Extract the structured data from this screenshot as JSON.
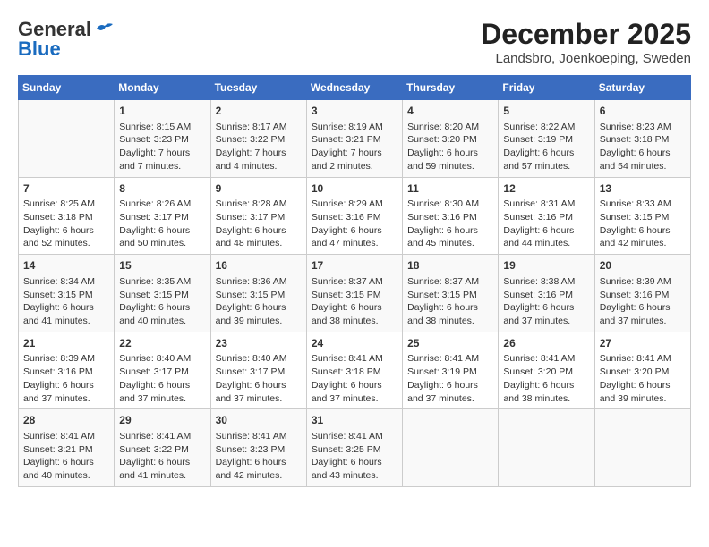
{
  "header": {
    "logo_general": "General",
    "logo_blue": "Blue",
    "title": "December 2025",
    "subtitle": "Landsbro, Joenkoeping, Sweden"
  },
  "days_of_week": [
    "Sunday",
    "Monday",
    "Tuesday",
    "Wednesday",
    "Thursday",
    "Friday",
    "Saturday"
  ],
  "weeks": [
    [
      {
        "day": "",
        "info": ""
      },
      {
        "day": "1",
        "info": "Sunrise: 8:15 AM\nSunset: 3:23 PM\nDaylight: 7 hours\nand 7 minutes."
      },
      {
        "day": "2",
        "info": "Sunrise: 8:17 AM\nSunset: 3:22 PM\nDaylight: 7 hours\nand 4 minutes."
      },
      {
        "day": "3",
        "info": "Sunrise: 8:19 AM\nSunset: 3:21 PM\nDaylight: 7 hours\nand 2 minutes."
      },
      {
        "day": "4",
        "info": "Sunrise: 8:20 AM\nSunset: 3:20 PM\nDaylight: 6 hours\nand 59 minutes."
      },
      {
        "day": "5",
        "info": "Sunrise: 8:22 AM\nSunset: 3:19 PM\nDaylight: 6 hours\nand 57 minutes."
      },
      {
        "day": "6",
        "info": "Sunrise: 8:23 AM\nSunset: 3:18 PM\nDaylight: 6 hours\nand 54 minutes."
      }
    ],
    [
      {
        "day": "7",
        "info": "Sunrise: 8:25 AM\nSunset: 3:18 PM\nDaylight: 6 hours\nand 52 minutes."
      },
      {
        "day": "8",
        "info": "Sunrise: 8:26 AM\nSunset: 3:17 PM\nDaylight: 6 hours\nand 50 minutes."
      },
      {
        "day": "9",
        "info": "Sunrise: 8:28 AM\nSunset: 3:17 PM\nDaylight: 6 hours\nand 48 minutes."
      },
      {
        "day": "10",
        "info": "Sunrise: 8:29 AM\nSunset: 3:16 PM\nDaylight: 6 hours\nand 47 minutes."
      },
      {
        "day": "11",
        "info": "Sunrise: 8:30 AM\nSunset: 3:16 PM\nDaylight: 6 hours\nand 45 minutes."
      },
      {
        "day": "12",
        "info": "Sunrise: 8:31 AM\nSunset: 3:16 PM\nDaylight: 6 hours\nand 44 minutes."
      },
      {
        "day": "13",
        "info": "Sunrise: 8:33 AM\nSunset: 3:15 PM\nDaylight: 6 hours\nand 42 minutes."
      }
    ],
    [
      {
        "day": "14",
        "info": "Sunrise: 8:34 AM\nSunset: 3:15 PM\nDaylight: 6 hours\nand 41 minutes."
      },
      {
        "day": "15",
        "info": "Sunrise: 8:35 AM\nSunset: 3:15 PM\nDaylight: 6 hours\nand 40 minutes."
      },
      {
        "day": "16",
        "info": "Sunrise: 8:36 AM\nSunset: 3:15 PM\nDaylight: 6 hours\nand 39 minutes."
      },
      {
        "day": "17",
        "info": "Sunrise: 8:37 AM\nSunset: 3:15 PM\nDaylight: 6 hours\nand 38 minutes."
      },
      {
        "day": "18",
        "info": "Sunrise: 8:37 AM\nSunset: 3:15 PM\nDaylight: 6 hours\nand 38 minutes."
      },
      {
        "day": "19",
        "info": "Sunrise: 8:38 AM\nSunset: 3:16 PM\nDaylight: 6 hours\nand 37 minutes."
      },
      {
        "day": "20",
        "info": "Sunrise: 8:39 AM\nSunset: 3:16 PM\nDaylight: 6 hours\nand 37 minutes."
      }
    ],
    [
      {
        "day": "21",
        "info": "Sunrise: 8:39 AM\nSunset: 3:16 PM\nDaylight: 6 hours\nand 37 minutes."
      },
      {
        "day": "22",
        "info": "Sunrise: 8:40 AM\nSunset: 3:17 PM\nDaylight: 6 hours\nand 37 minutes."
      },
      {
        "day": "23",
        "info": "Sunrise: 8:40 AM\nSunset: 3:17 PM\nDaylight: 6 hours\nand 37 minutes."
      },
      {
        "day": "24",
        "info": "Sunrise: 8:41 AM\nSunset: 3:18 PM\nDaylight: 6 hours\nand 37 minutes."
      },
      {
        "day": "25",
        "info": "Sunrise: 8:41 AM\nSunset: 3:19 PM\nDaylight: 6 hours\nand 37 minutes."
      },
      {
        "day": "26",
        "info": "Sunrise: 8:41 AM\nSunset: 3:20 PM\nDaylight: 6 hours\nand 38 minutes."
      },
      {
        "day": "27",
        "info": "Sunrise: 8:41 AM\nSunset: 3:20 PM\nDaylight: 6 hours\nand 39 minutes."
      }
    ],
    [
      {
        "day": "28",
        "info": "Sunrise: 8:41 AM\nSunset: 3:21 PM\nDaylight: 6 hours\nand 40 minutes."
      },
      {
        "day": "29",
        "info": "Sunrise: 8:41 AM\nSunset: 3:22 PM\nDaylight: 6 hours\nand 41 minutes."
      },
      {
        "day": "30",
        "info": "Sunrise: 8:41 AM\nSunset: 3:23 PM\nDaylight: 6 hours\nand 42 minutes."
      },
      {
        "day": "31",
        "info": "Sunrise: 8:41 AM\nSunset: 3:25 PM\nDaylight: 6 hours\nand 43 minutes."
      },
      {
        "day": "",
        "info": ""
      },
      {
        "day": "",
        "info": ""
      },
      {
        "day": "",
        "info": ""
      }
    ]
  ]
}
